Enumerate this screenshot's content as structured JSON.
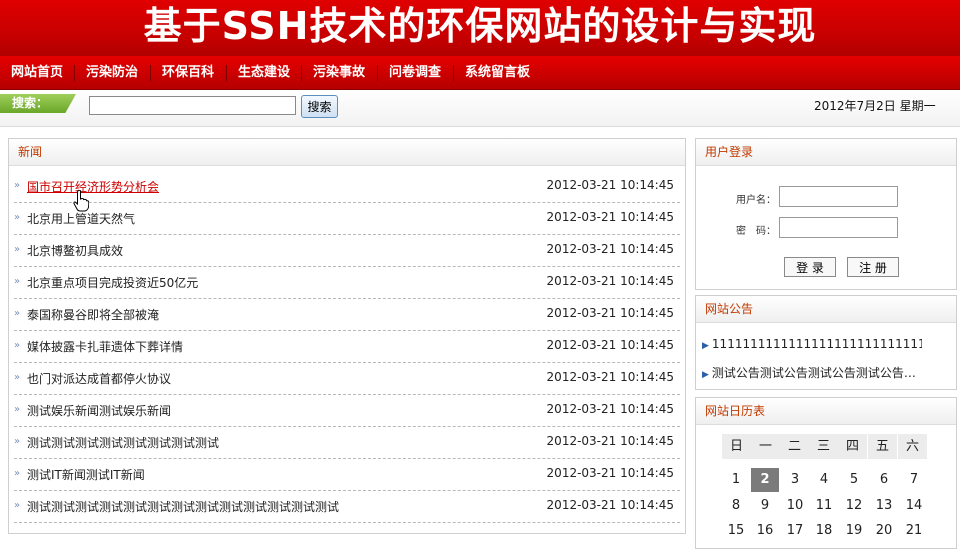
{
  "site": {
    "title": "基于SSH技术的环保网站的设计与实现"
  },
  "nav": {
    "items": [
      "网站首页",
      "污染防治",
      "环保百科",
      "生态建设",
      "污染事故",
      "问卷调查",
      "系统留言板"
    ]
  },
  "search": {
    "label": "搜索：",
    "button": "搜索",
    "value": ""
  },
  "date_text": "2012年7月2日  星期一",
  "news": {
    "heading": "新闻",
    "items": [
      {
        "title": "国市召开经济形势分析会",
        "time": "2012-03-21 10:14:45"
      },
      {
        "title": "北京用上管道天然气",
        "time": "2012-03-21 10:14:45"
      },
      {
        "title": "北京博鳌初具成效",
        "time": "2012-03-21 10:14:45"
      },
      {
        "title": "北京重点项目完成投资近50亿元",
        "time": "2012-03-21 10:14:45"
      },
      {
        "title": "泰国称曼谷即将全部被淹",
        "time": "2012-03-21 10:14:45"
      },
      {
        "title": "媒体披露卡扎菲遗体下葬详情",
        "time": "2012-03-21 10:14:45"
      },
      {
        "title": "也门对派达成首都停火协议",
        "time": "2012-03-21 10:14:45"
      },
      {
        "title": "测试娱乐新闻测试娱乐新闻",
        "time": "2012-03-21 10:14:45"
      },
      {
        "title": "测试测试测试测试测试测试测试测试",
        "time": "2012-03-21 10:14:45"
      },
      {
        "title": "测试IT新闻测试IT新闻",
        "time": "2012-03-21 10:14:45"
      },
      {
        "title": "测试测试测试测试测试测试测试测试测试测试测试测试测试",
        "time": "2012-03-21 10:14:45"
      }
    ]
  },
  "login": {
    "heading": "用户登录",
    "username_label": "用户名：",
    "password_label": "密　码：",
    "login_button": "登 录",
    "register_button": "注 册"
  },
  "notice": {
    "heading": "网站公告",
    "items": [
      "1111111111111111111111111111111",
      "测试公告测试公告测试公告测试公告…"
    ]
  },
  "calendar": {
    "heading": "网站日历表",
    "weekdays": [
      "日",
      "一",
      "二",
      "三",
      "四",
      "五",
      "六"
    ],
    "rows": [
      [
        "1",
        "2",
        "3",
        "4",
        "5",
        "6",
        "7"
      ],
      [
        "8",
        "9",
        "10",
        "11",
        "12",
        "13",
        "14"
      ],
      [
        "15",
        "16",
        "17",
        "18",
        "19",
        "20",
        "21"
      ]
    ],
    "today": "2"
  },
  "colors": {
    "banner_red": "#d40000",
    "panel_title": "#c03a00",
    "today_bg": "#7b7b7b",
    "search_label_green": "#7ab83a"
  }
}
